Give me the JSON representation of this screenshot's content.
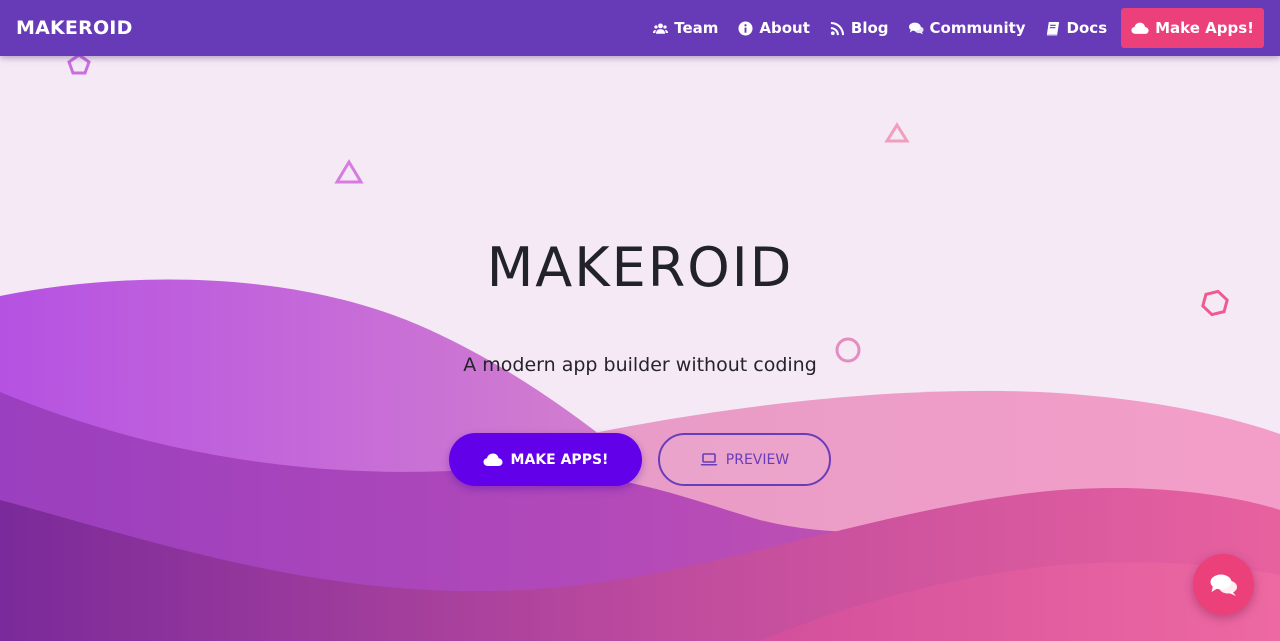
{
  "navbar": {
    "brand": "MAKEROID",
    "items": [
      {
        "label": "Team",
        "icon": "users-icon"
      },
      {
        "label": "About",
        "icon": "info-icon"
      },
      {
        "label": "Blog",
        "icon": "rss-icon"
      },
      {
        "label": "Community",
        "icon": "comments-icon"
      },
      {
        "label": "Docs",
        "icon": "book-icon"
      }
    ],
    "cta": {
      "label": "Make Apps!",
      "icon": "cloud-icon"
    }
  },
  "hero": {
    "title": "MAKEROID",
    "subtitle": "A modern app builder without coding",
    "primary_button": {
      "label": "MAKE APPS!",
      "icon": "cloud-icon"
    },
    "secondary_button": {
      "label": "PREVIEW",
      "icon": "laptop-icon"
    }
  },
  "chat_fab": {
    "icon": "chat-icon"
  },
  "colors": {
    "navbar": "#673ab7",
    "accent_pink": "#ec407a",
    "primary_button": "#6200ea",
    "background": "#f4e9f5",
    "wave_purple": "#b84fe0",
    "wave_pink": "#e86aa8"
  }
}
